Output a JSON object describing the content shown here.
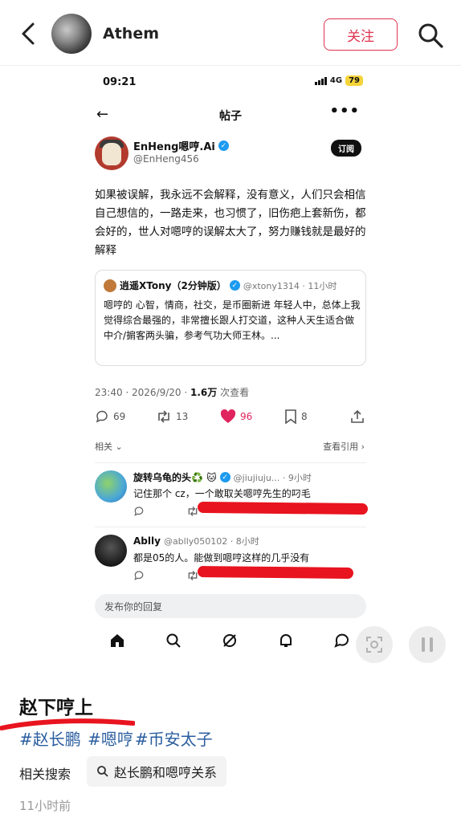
{
  "header": {
    "author_name": "Athem",
    "follow_label": "关注"
  },
  "screenshot": {
    "status": {
      "time": "09:21",
      "network": "4G",
      "battery": "79"
    },
    "nav": {
      "back": "←",
      "title": "帖子",
      "more": "•••"
    },
    "tweet": {
      "display_name": "EnHeng嗯哼.Ai",
      "handle": "@EnHeng456",
      "subscribe_label": "订阅",
      "text": "如果被误解，我永远不会解释，没有意义，人们只会相信自己想信的，一路走来，也习惯了，旧伤疤上套新伤，都会好的，世人对嗯哼的误解太大了，努力赚钱就是最好的解释",
      "quote": {
        "name": "逍遥XTony（2分钟版）",
        "meta": "@xtony1314 · 11小时",
        "text": "嗯哼的 心智，情商，社交，是币圈新进 年轻人中，总体上我觉得综合最强的，非常擅长跟人打交道，这种人天生适合做中介/掮客两头骗，参考气功大师王林。..."
      },
      "timestamp": "23:40 · 2026/9/20 · ",
      "views_count": "1.6万",
      "views_label": " 次查看",
      "stats": {
        "replies": "69",
        "reposts": "13",
        "likes": "96",
        "bookmarks": "8"
      },
      "related_label": "相关",
      "view_quotes_label": "查看引用"
    },
    "replies": [
      {
        "name": "旋转乌龟的头♻️ 🐱",
        "meta": "@jiujiuju... · 9小时",
        "text": "记住那个 cz，一个敢取关嗯哼先生的叼毛"
      },
      {
        "name": "Ablly",
        "meta": "@ablly050102 · 8小时",
        "text": "都是05的人。能做到嗯哼这样的几乎没有"
      }
    ],
    "reply_placeholder": "发布你的回复"
  },
  "caption": {
    "title": "赵下哼上",
    "hashtags": [
      "#赵长鹏",
      "#嗯哼",
      "#币安太子"
    ],
    "related_search_label": "相关搜索",
    "related_search_query": "赵长鹏和嗯哼关系",
    "time_ago": "11小时前"
  },
  "colors": {
    "accent": "#e0334f",
    "link": "#2a5d9f",
    "like": "#e0245e",
    "redaction": "#e8141f",
    "verified": "#1d9bf0"
  },
  "icons": [
    "back-icon",
    "search-icon",
    "verified-icon",
    "reply-icon",
    "repost-icon",
    "like-icon",
    "bookmark-icon",
    "share-icon",
    "home-icon",
    "grok-icon",
    "bell-icon",
    "message-icon",
    "screenshot-scan-icon",
    "pause-icon"
  ]
}
